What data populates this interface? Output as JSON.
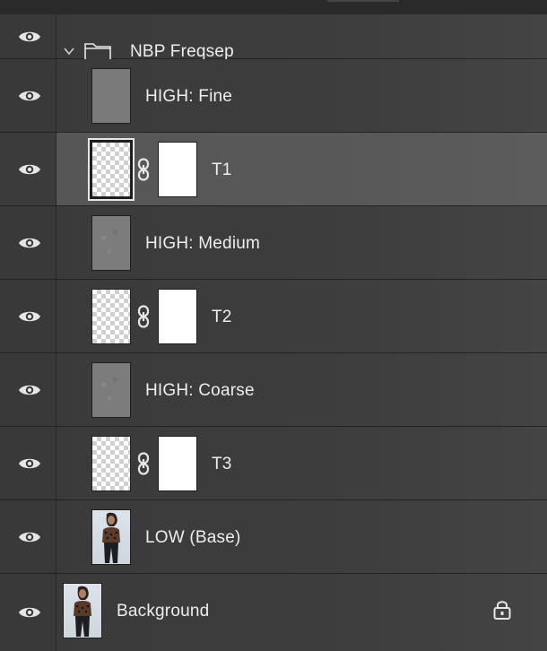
{
  "panel": "layers",
  "layers": [
    {
      "name": "NBP Freqsep",
      "type": "group",
      "visible": true,
      "expanded": true
    },
    {
      "name": "HIGH: Fine",
      "type": "pixel",
      "visible": true,
      "thumbnail": "gray"
    },
    {
      "name": "T1",
      "type": "adjustment-with-mask",
      "visible": true,
      "selected": true,
      "thumbnail": "transparent",
      "mask": "white"
    },
    {
      "name": "HIGH: Medium",
      "type": "pixel",
      "visible": true,
      "thumbnail": "gray"
    },
    {
      "name": "T2",
      "type": "adjustment-with-mask",
      "visible": true,
      "thumbnail": "transparent",
      "mask": "white"
    },
    {
      "name": "HIGH: Coarse",
      "type": "pixel",
      "visible": true,
      "thumbnail": "gray"
    },
    {
      "name": "T3",
      "type": "adjustment-with-mask",
      "visible": true,
      "thumbnail": "transparent",
      "mask": "white"
    },
    {
      "name": "LOW (Base)",
      "type": "pixel",
      "visible": true,
      "thumbnail": "photo"
    },
    {
      "name": "Background",
      "type": "background",
      "visible": true,
      "locked": true,
      "thumbnail": "photo"
    }
  ],
  "icons": {
    "visibility": "eye-icon",
    "expand": "chevron-down-icon",
    "group": "folder-icon",
    "link": "chain-link-icon",
    "lock": "lock-icon"
  }
}
